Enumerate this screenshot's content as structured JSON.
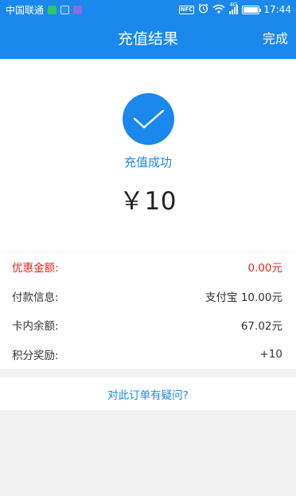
{
  "status_bar": {
    "carrier": "中国联通",
    "nfc": "NFC",
    "network": "4G",
    "time": "17:44",
    "battery_level": 1.0
  },
  "header": {
    "title": "充值结果",
    "done_label": "完成"
  },
  "result": {
    "status_text": "充值成功",
    "amount": "￥10",
    "icon": "check-icon"
  },
  "details": [
    {
      "label": "优惠金额:",
      "value": "0.00元",
      "highlight": true
    },
    {
      "label": "付款信息:",
      "value": "支付宝 10.00元",
      "highlight": false
    },
    {
      "label": "卡内余额:",
      "value": "67.02元",
      "highlight": false
    },
    {
      "label": "积分奖励:",
      "value": "+10",
      "highlight": false
    }
  ],
  "help": {
    "question_label": "对此订单有疑问?"
  },
  "colors": {
    "primary": "#1a88ec",
    "highlight": "#e8261c",
    "background": "#f2f2f2"
  }
}
